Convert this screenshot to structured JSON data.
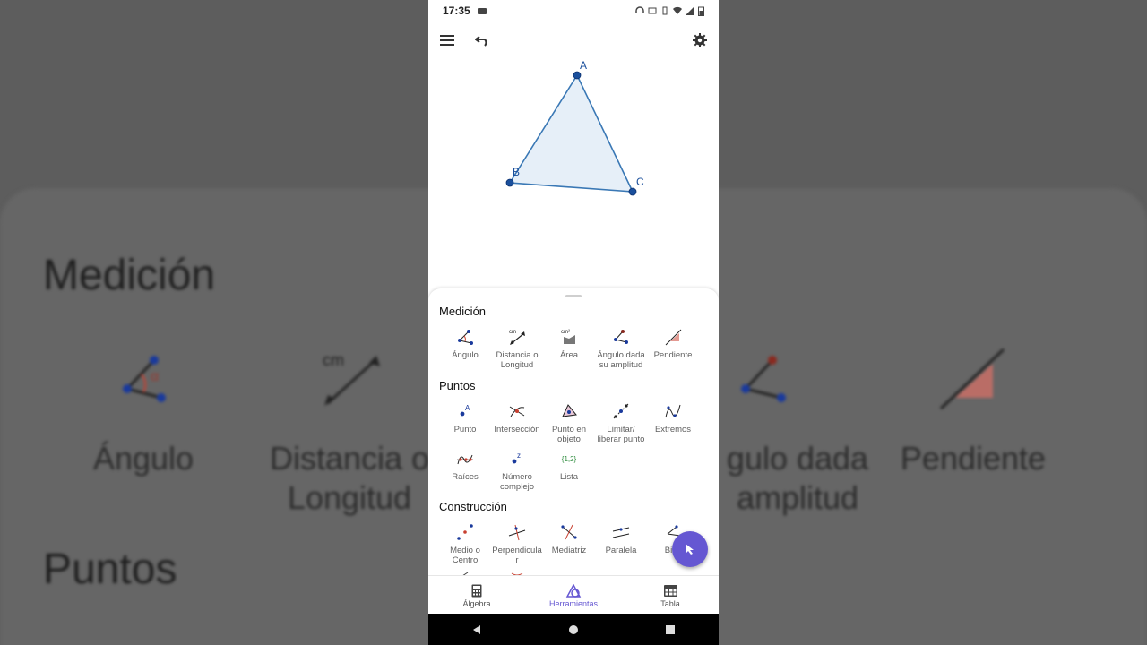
{
  "status_bar": {
    "time": "17:35"
  },
  "background": {
    "section1": "Medición",
    "section2": "Puntos",
    "labels": [
      "Ángulo",
      "Distancia o\nLongitud",
      "gulo dada\namplitud",
      "Pendiente"
    ],
    "cm": "cm",
    "alpha": "α"
  },
  "geometry": {
    "points": [
      {
        "label": "A"
      },
      {
        "label": "B"
      },
      {
        "label": "C"
      }
    ],
    "colors": {
      "stroke": "#3a78b5",
      "fill": "#e6eff8",
      "point": "#1a4f9c"
    }
  },
  "tools_panel": {
    "sections": [
      {
        "title": "Medición",
        "tools": [
          {
            "label": "Ángulo",
            "icon": "angle-icon"
          },
          {
            "label": "Distancia o\nLongitud",
            "icon": "distance-icon"
          },
          {
            "label": "Área",
            "icon": "area-icon"
          },
          {
            "label": "Ángulo dada\nsu amplitud",
            "icon": "angle-fixed-icon"
          },
          {
            "label": "Pendiente",
            "icon": "slope-icon"
          }
        ]
      },
      {
        "title": "Puntos",
        "tools": [
          {
            "label": "Punto",
            "icon": "point-icon"
          },
          {
            "label": "Intersección",
            "icon": "intersection-icon"
          },
          {
            "label": "Punto en\nobjeto",
            "icon": "point-on-object-icon"
          },
          {
            "label": "Limitar/\nliberar punto",
            "icon": "attach-detach-icon"
          },
          {
            "label": "Extremos",
            "icon": "extremum-icon"
          },
          {
            "label": "Raíces",
            "icon": "roots-icon"
          },
          {
            "label": "Número\ncomplejo",
            "icon": "complex-number-icon"
          },
          {
            "label": "Lista",
            "icon": "list-icon",
            "glyph": "{1,2}"
          }
        ]
      },
      {
        "title": "Construcción",
        "tools": [
          {
            "label": "Medio o\nCentro",
            "icon": "midpoint-icon"
          },
          {
            "label": "Perpendicula\nr",
            "icon": "perpendicular-icon"
          },
          {
            "label": "Mediatriz",
            "icon": "perpendicular-bisector-icon"
          },
          {
            "label": "Paralela",
            "icon": "parallel-icon"
          },
          {
            "label": "Bise",
            "icon": "angle-bisector-icon"
          }
        ]
      }
    ]
  },
  "bottom_nav": {
    "items": [
      {
        "label": "Álgebra",
        "icon": "calculator-icon"
      },
      {
        "label": "Herramientas",
        "icon": "tools-icon",
        "active": true
      },
      {
        "label": "Tabla",
        "icon": "table-icon"
      }
    ]
  },
  "theme": {
    "accent": "#6557d2"
  }
}
